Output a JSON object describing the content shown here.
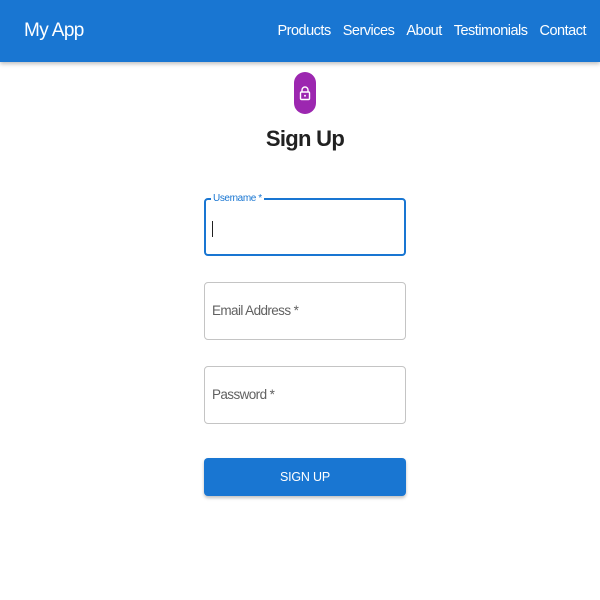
{
  "appbar": {
    "brand": "My App",
    "nav": [
      "Products",
      "Services",
      "About",
      "Testimonials",
      "Contact"
    ]
  },
  "page": {
    "icon": "lock-icon",
    "title": "Sign Up"
  },
  "form": {
    "username": {
      "label": "Username *",
      "value": ""
    },
    "email": {
      "label": "Email Address *",
      "value": ""
    },
    "password": {
      "label": "Password *",
      "value": ""
    },
    "submit_label": "SIGN UP"
  },
  "colors": {
    "primary": "#1976d2",
    "avatar": "#9c27b0",
    "border": "#c4c4c4"
  }
}
